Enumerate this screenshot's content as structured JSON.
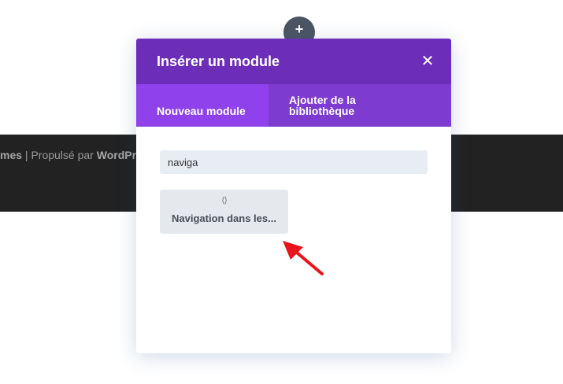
{
  "footer": {
    "prefix": "mes",
    "separator": " | ",
    "powered_by": "Propulsé par ",
    "brand": "WordPr"
  },
  "builder": {
    "add_icon": "plus-icon"
  },
  "modal": {
    "title": "Insérer un module",
    "close_icon": "✕",
    "tabs": [
      {
        "label": "Nouveau module",
        "active": true
      },
      {
        "label": "Ajouter de la bibliothèque",
        "active": false
      }
    ],
    "search": {
      "value": "naviga"
    },
    "results": [
      {
        "label": "Navigation dans les...",
        "icon": "post-navigation-icon",
        "icon_glyph": "⟨⟩"
      }
    ]
  },
  "colors": {
    "header": "#6c2eb9",
    "tabs_bg": "#7e3bd0",
    "active_tab": "#8f42ec",
    "annotation_arrow": "#e8141b"
  }
}
